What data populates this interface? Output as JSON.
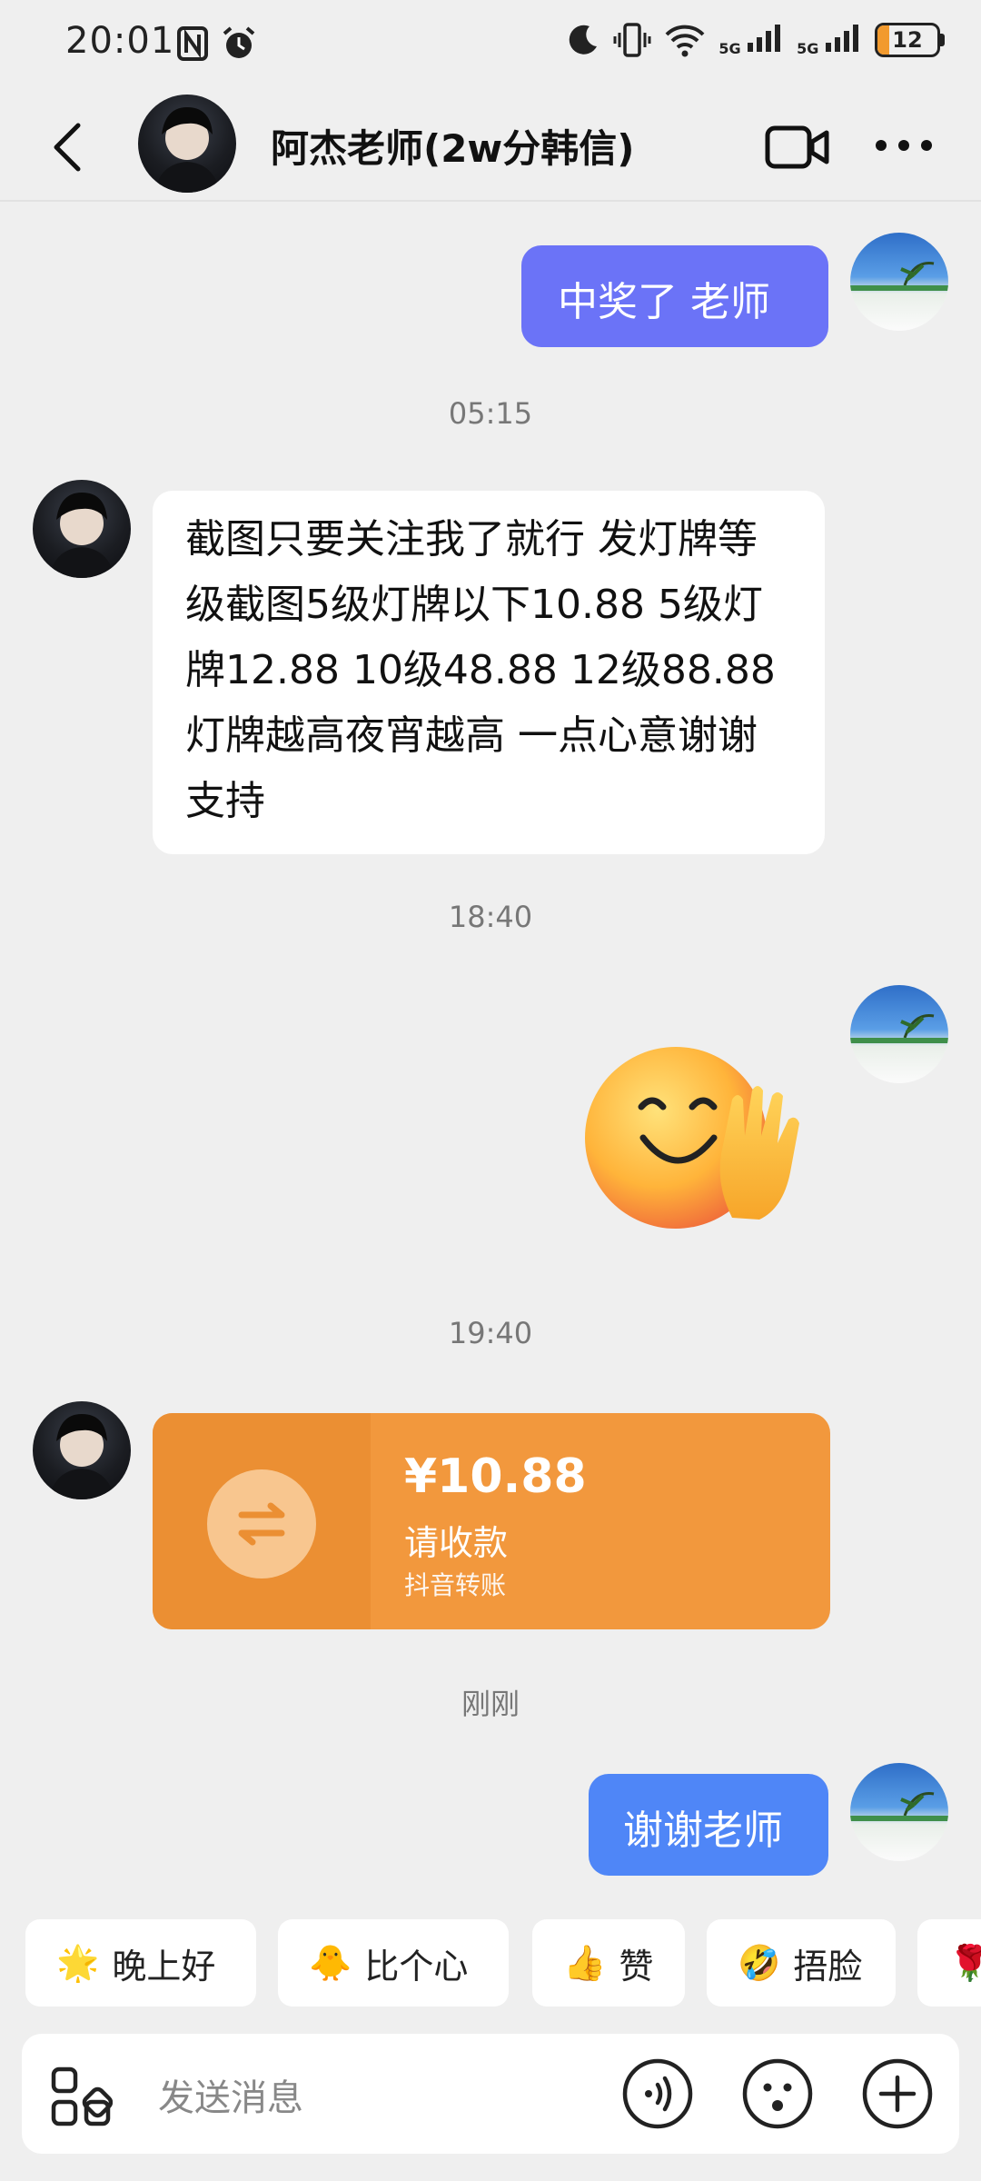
{
  "status_bar": {
    "time": "20:01",
    "network1": "5G",
    "network2": "5G",
    "battery": "12"
  },
  "header": {
    "title": "阿杰老师(2w分韩信)"
  },
  "messages": {
    "m1_text": "中奖了  老师",
    "ts1": "05:15",
    "m2_text": "截图只要关注我了就行 发灯牌等级截图5级灯牌以下10.88 5级灯牌12.88 10级48.88 12级88.88 灯牌越高夜宵越高 一点心意谢谢支持",
    "ts2": "18:40",
    "ts3": "19:40",
    "transfer_amount": "¥10.88",
    "transfer_label": "请收款",
    "transfer_source": "抖音转账",
    "ts4": "刚刚",
    "m5_text": "谢谢老师"
  },
  "quick_replies": [
    {
      "emoji": "🌟",
      "label": "晚上好"
    },
    {
      "emoji": "🐥",
      "label": "比个心"
    },
    {
      "emoji": "👍",
      "label": "赞"
    },
    {
      "emoji": "🤣",
      "label": "捂脸"
    },
    {
      "emoji": "🌹",
      "label": ""
    }
  ],
  "input": {
    "placeholder": "发送消息"
  },
  "colors": {
    "sent_bubble_1": "#6b73f7",
    "sent_bubble_2": "#4f86f7",
    "transfer_card": "#f2983d",
    "battery_fill": "#f29a2e"
  }
}
